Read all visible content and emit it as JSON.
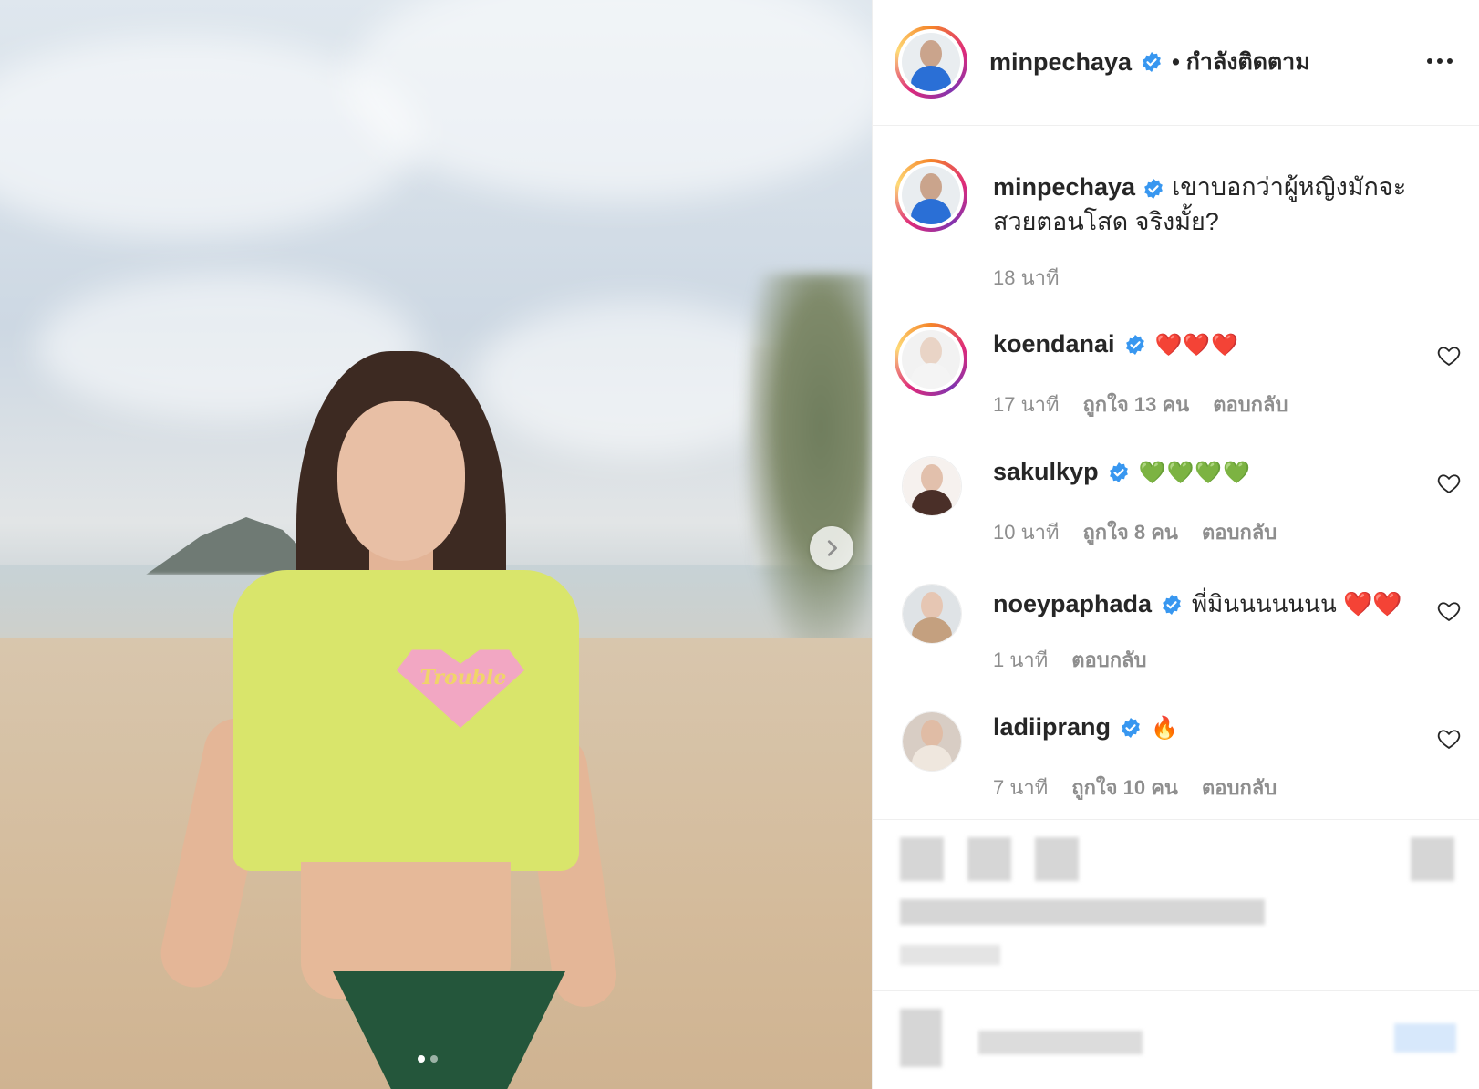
{
  "post": {
    "username": "minpechaya",
    "follow_status": "• กำลังติดตาม",
    "caption": "เขาบอกว่าผู้หญิงมักจะสวยตอนโสด จริงมั้ย?",
    "time": "18 นาที",
    "photo_text": "Trouble",
    "carousel": {
      "total": 2,
      "active": 1
    }
  },
  "comments": [
    {
      "username": "koendanai",
      "text": "❤️❤️❤️",
      "time": "17 นาที",
      "likes": "ถูกใจ 13 คน",
      "reply": "ตอบกลับ"
    },
    {
      "username": "sakulkyp",
      "text": "💚💚💚💚",
      "time": "10 นาที",
      "likes": "ถูกใจ 8 คน",
      "reply": "ตอบกลับ"
    },
    {
      "username": "noeypaphada",
      "text": "พี่มินนนนนนน ❤️❤️",
      "time": "1 นาที",
      "likes": "",
      "reply": "ตอบกลับ"
    },
    {
      "username": "ladiiprang",
      "text": "🔥",
      "time": "7 นาที",
      "likes": "ถูกใจ 10 คน",
      "reply": "ตอบกลับ"
    }
  ],
  "icons": {
    "more": "more-horizontal-icon",
    "verified": "verified-badge-icon",
    "like": "heart-outline-icon",
    "next": "chevron-right-icon"
  },
  "colors": {
    "verified": "#3897f0",
    "text": "#262626",
    "muted": "#8e8e8e",
    "divider": "#efefef"
  }
}
